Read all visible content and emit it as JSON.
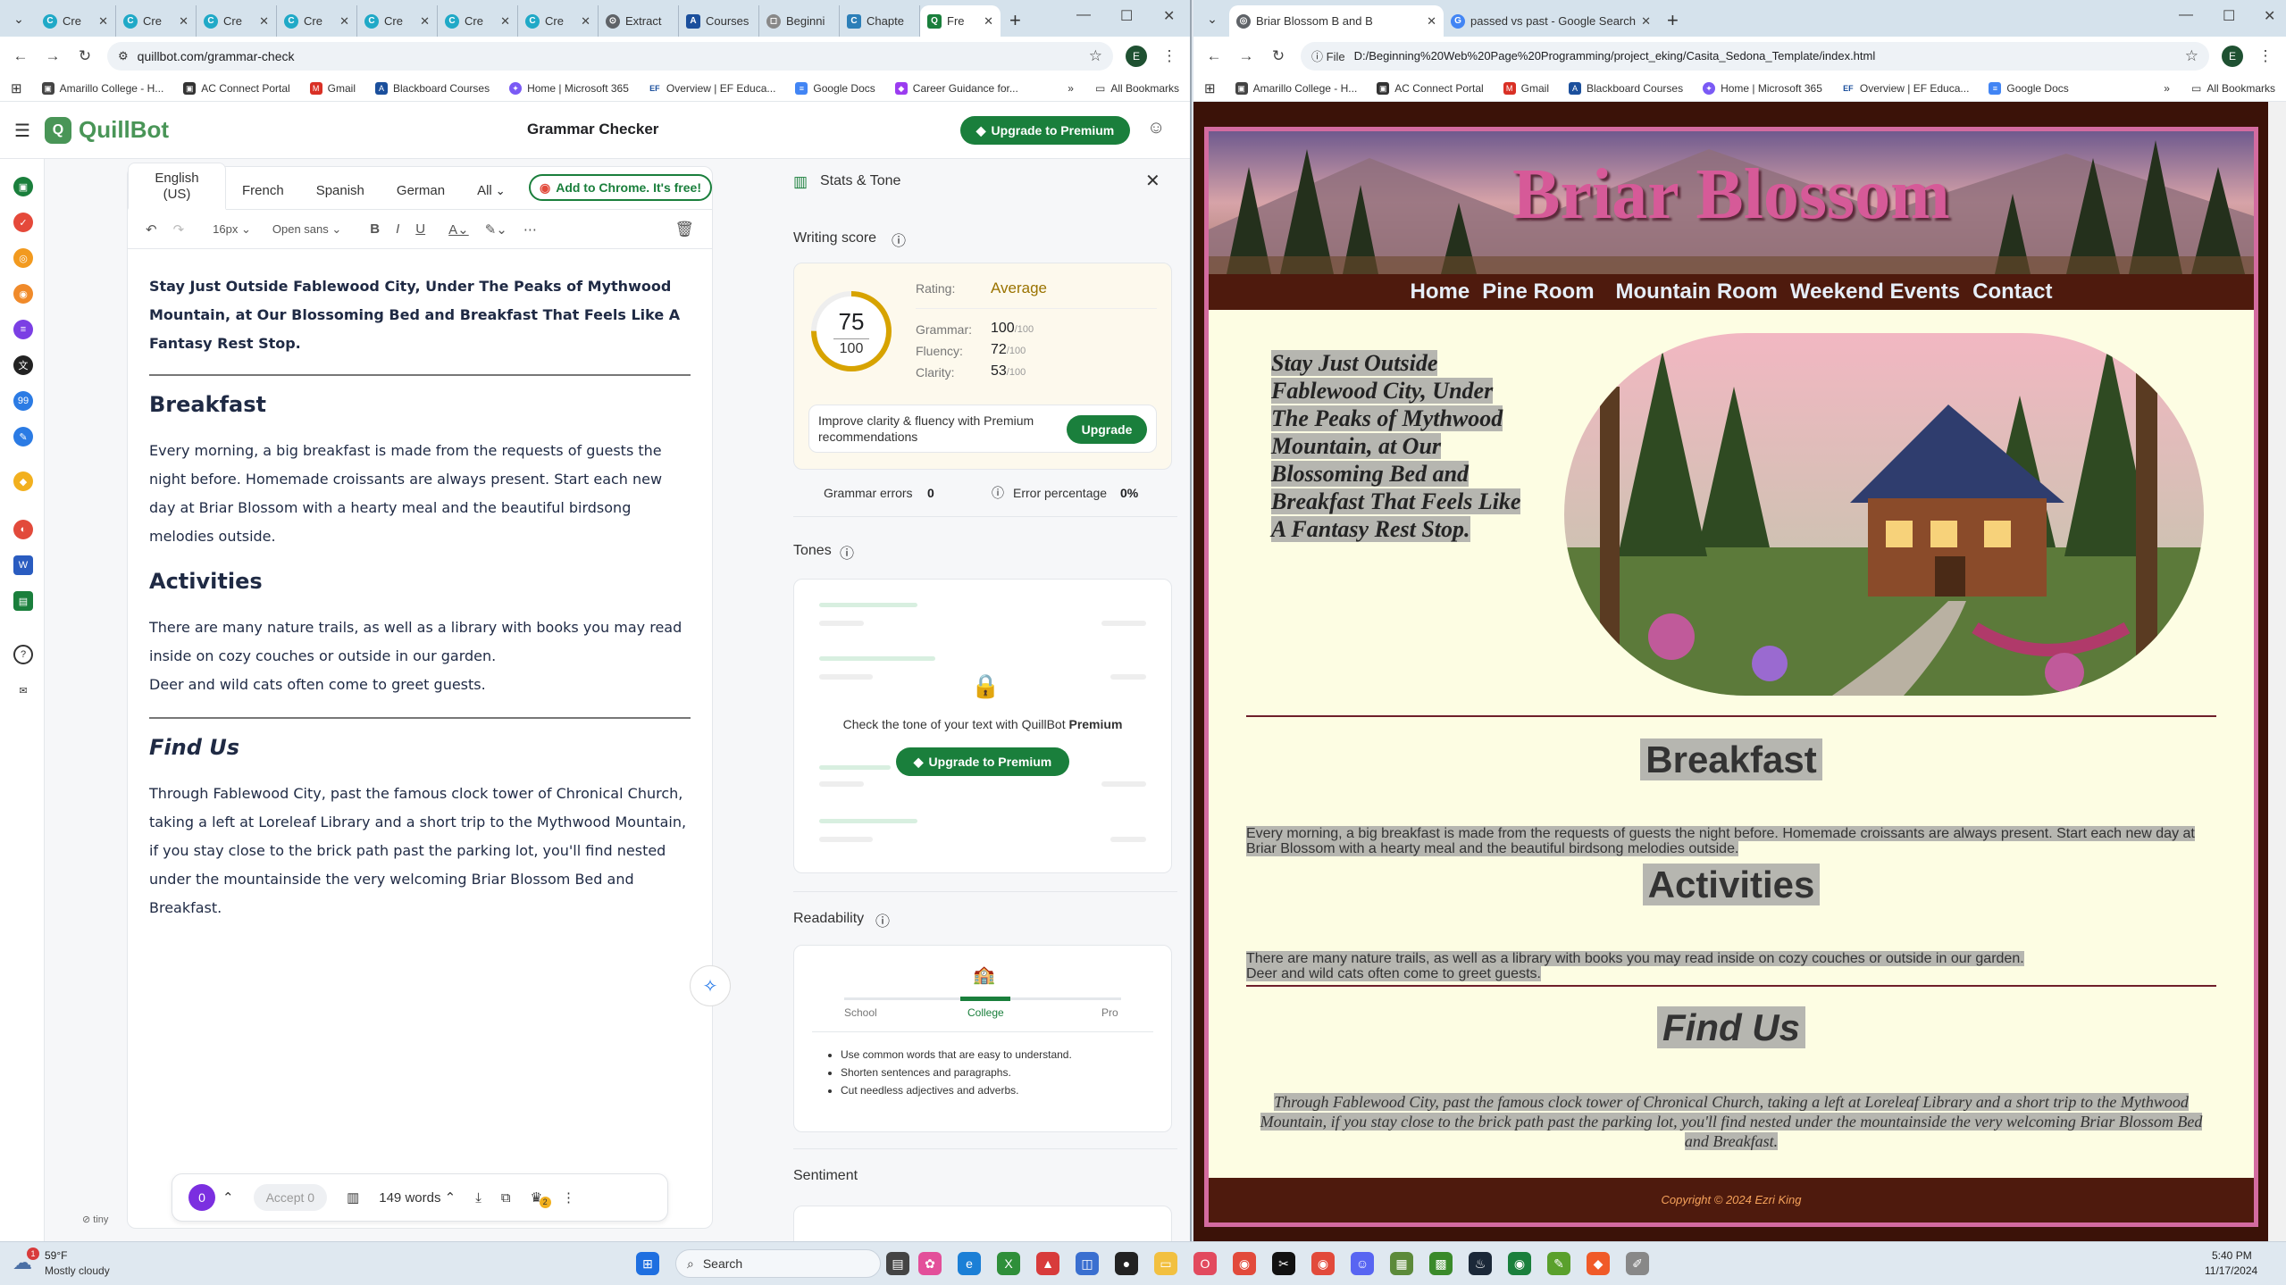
{
  "left_browser": {
    "tabs": [
      "Cre",
      "Cre",
      "Cre",
      "Cre",
      "Cre",
      "Cre",
      "Cre",
      "Extract",
      "Courses",
      "Beginni",
      "Chapte",
      "Fre"
    ],
    "url": "quillbot.com/grammar-check",
    "bookmarks": [
      "Amarillo College - H...",
      "AC Connect Portal",
      "Gmail",
      "Blackboard Courses",
      "Home | Microsoft 365",
      "Overview | EF Educa...",
      "Google Docs",
      "Career Guidance for..."
    ],
    "all_bookmarks": "All Bookmarks",
    "profile_initial": "E"
  },
  "quillbot": {
    "brand": "QuillBot",
    "title": "Grammar Checker",
    "upgrade_label": "Upgrade to Premium",
    "languages": [
      "English (US)",
      "French",
      "Spanish",
      "German",
      "All"
    ],
    "chrome_label": "Add to Chrome. It's free!",
    "font_size": "16px",
    "font_name": "Open sans",
    "editor": {
      "lead": "Stay Just Outside Fablewood City, Under The Peaks of Mythwood Mountain, at Our Blossoming Bed and Breakfast That Feels Like A Fantasy Rest Stop.",
      "h_breakfast": "Breakfast",
      "p_breakfast": "Every morning, a big breakfast is made from the requests of guests the night before. Homemade croissants are always present. Start each new day at Briar Blossom with a hearty meal and the beautiful birdsong melodies outside.",
      "h_activities": "Activities",
      "p_activities_1": "There are many nature trails, as well as a library with books you may read inside on cozy couches or outside in our garden.",
      "p_activities_2": "Deer and wild cats often come to greet guests.",
      "h_find": "Find Us",
      "p_find": "Through Fablewood City, past the famous clock tower of Chronical Church, taking a left at Loreleaf Library and a short trip to the Mythwood Mountain, if you stay close to the brick path past the parking lot, you'll find nested under the mountainside the very welcoming Briar Blossom Bed and Breakfast."
    },
    "bottom": {
      "count": "0",
      "accept": "Accept 0",
      "words": "149 words",
      "badge": "2"
    },
    "tiny": "tiny",
    "stats": {
      "header": "Stats & Tone",
      "writing_score": "Writing score",
      "score": "75",
      "score_max": "100",
      "score_progress": 0.75,
      "rating_label": "Rating:",
      "rating": "Average",
      "metrics": [
        {
          "name": "Grammar:",
          "value": "100",
          "max": "/100"
        },
        {
          "name": "Fluency:",
          "value": "72",
          "max": "/100"
        },
        {
          "name": "Clarity:",
          "value": "53",
          "max": "/100"
        }
      ],
      "improve": "Improve clarity & fluency with Premium recommendations",
      "upgrade": "Upgrade",
      "grammar_errors_label": "Grammar errors",
      "grammar_errors": "0",
      "error_pct_label": "Error percentage",
      "error_pct": "0%",
      "tones": "Tones",
      "tone_msg": "Check the tone of your text with QuillBot",
      "tone_premium": "Premium",
      "tone_upgrade": "Upgrade to Premium",
      "readability": "Readability",
      "read_levels": [
        "School",
        "College",
        "Pro"
      ],
      "read_active": "College",
      "read_tips": [
        "Use common words that are easy to understand.",
        "Shorten sentences and paragraphs.",
        "Cut needless adjectives and adverbs."
      ],
      "sentiment": "Sentiment"
    }
  },
  "right_browser": {
    "tabs": [
      "Briar Blossom B and B",
      "passed vs past - Google Search"
    ],
    "url_chip": "File",
    "url": "D:/Beginning%20Web%20Page%20Programming/project_eking/Casita_Sedona_Template/index.html",
    "bookmarks": [
      "Amarillo College - H...",
      "AC Connect Portal",
      "Gmail",
      "Blackboard Courses",
      "Home | Microsoft 365",
      "Overview | EF Educa...",
      "Google Docs"
    ],
    "all_bookmarks": "All Bookmarks",
    "profile_initial": "E"
  },
  "site": {
    "title": "Briar Blossom",
    "nav": [
      "Home",
      "Pine Room",
      "Mountain Room",
      "Weekend Events",
      "Contact"
    ],
    "intro": "Stay Just Outside Fablewood City, Under The Peaks of Mythwood Mountain, at Our Blossoming Bed and Breakfast That Feels Like A Fantasy Rest Stop.",
    "h_breakfast": "Breakfast",
    "p_breakfast": "Every morning, a big breakfast is made from the requests of guests the night before. Homemade croissants are always present. Start each new day at Briar Blossom with a hearty meal and the beautiful birdsong melodies outside.",
    "h_activities": "Activities",
    "p_activities_1": "There are many nature trails, as well as a library with books you may read inside on cozy couches or outside in our garden.",
    "p_activities_2": "Deer and wild cats often come to greet guests.",
    "h_find": "Find Us",
    "p_find": "Through Fablewood City, past the famous clock tower of Chronical Church, taking a left at Loreleaf Library and a short trip to the Mythwood Mountain, if you stay close to the brick path past the parking lot, you'll find nested under the mountainside the very welcoming Briar Blossom Bed and Breakfast.",
    "footer": "Copyright © 2024 Ezri King"
  },
  "taskbar": {
    "weather_temp": "59°F",
    "weather_desc": "Mostly cloudy",
    "weather_badge": "1",
    "search": "Search",
    "time": "5:40 PM",
    "date": "11/17/2024"
  },
  "colors": {
    "quill_green": "#1a7f3c",
    "site_bg": "#fdfde3",
    "site_border": "#d46ba0",
    "nav_bg": "#4e1a0d",
    "title_pink": "#d65a98"
  }
}
